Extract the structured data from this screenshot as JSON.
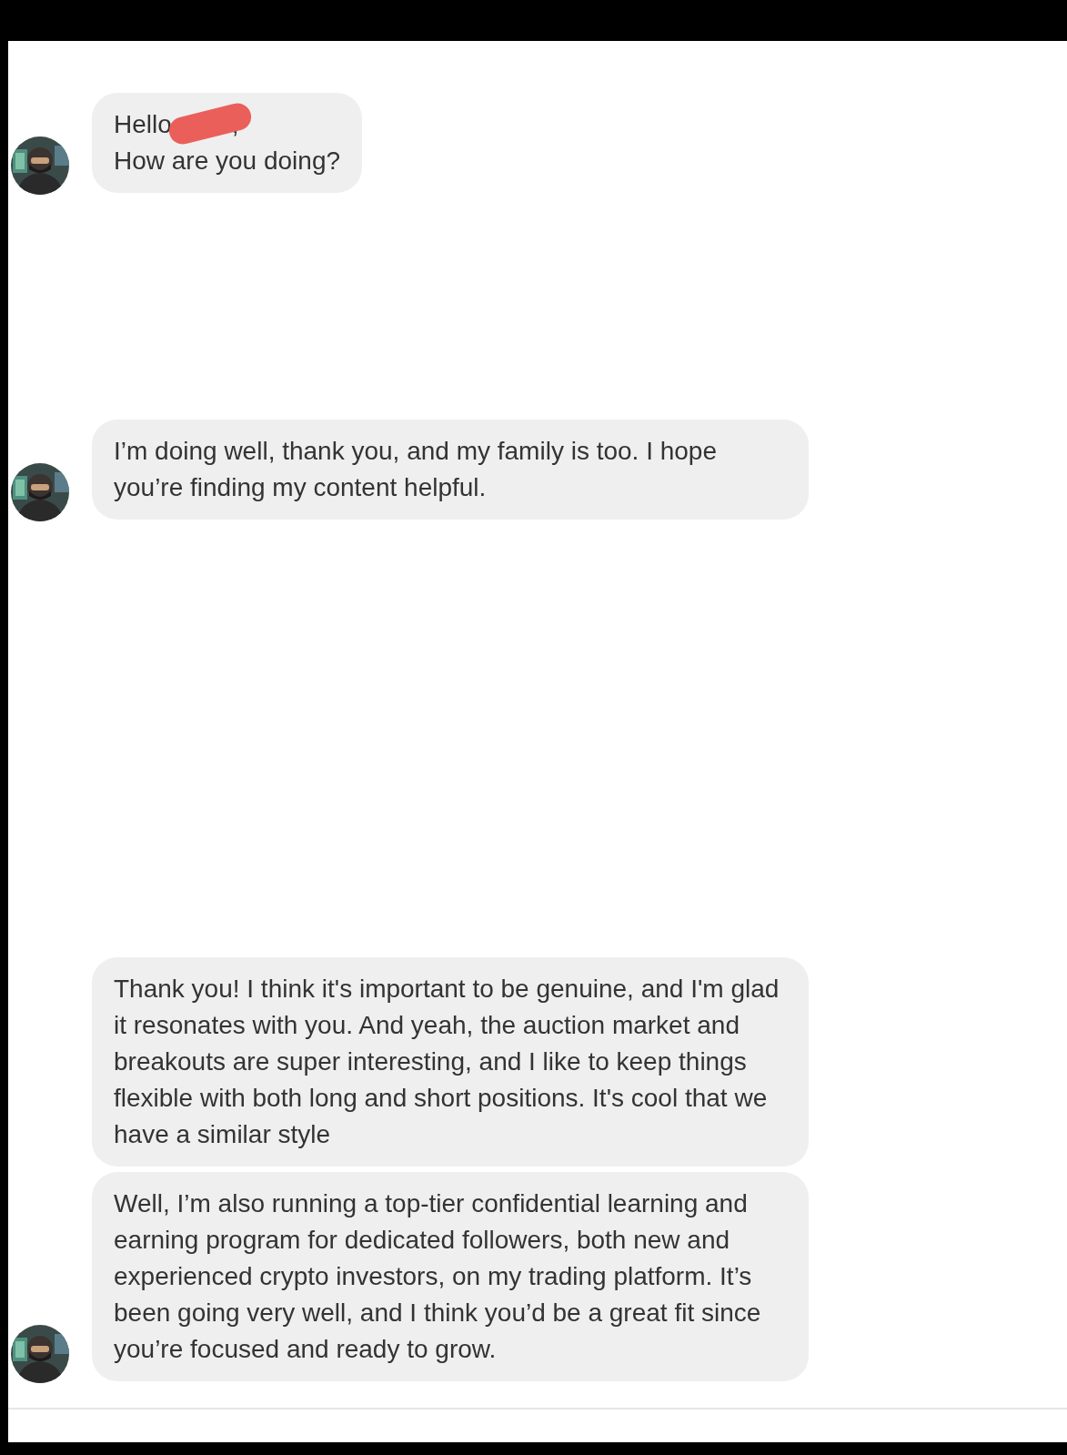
{
  "messages": [
    {
      "avatar": true,
      "bubbles": [
        {
          "lines": [
            "Hello",
            "How are you doing?"
          ],
          "redaction": {
            "tail": ","
          }
        }
      ]
    },
    {
      "avatar": true,
      "bubbles": [
        {
          "lines": [
            "I’m doing well, thank you, and my family is too. I hope you’re finding my content helpful."
          ]
        }
      ]
    },
    {
      "avatar": true,
      "bubbles": [
        {
          "lines": [
            "Thank you! I think it's important to be genuine, and I'm glad it resonates with you. And yeah, the auction market and breakouts are super interesting, and I like to keep things flexible with both long and short positions. It's cool that we have a similar style"
          ]
        },
        {
          "lines": [
            "Well, I’m also running a top-tier confidential learning and earning program for dedicated followers, both new and experienced crypto investors, on my trading platform. It’s been going very well, and I think you’d be a great fit since you’re focused and ready to grow."
          ]
        }
      ]
    }
  ]
}
